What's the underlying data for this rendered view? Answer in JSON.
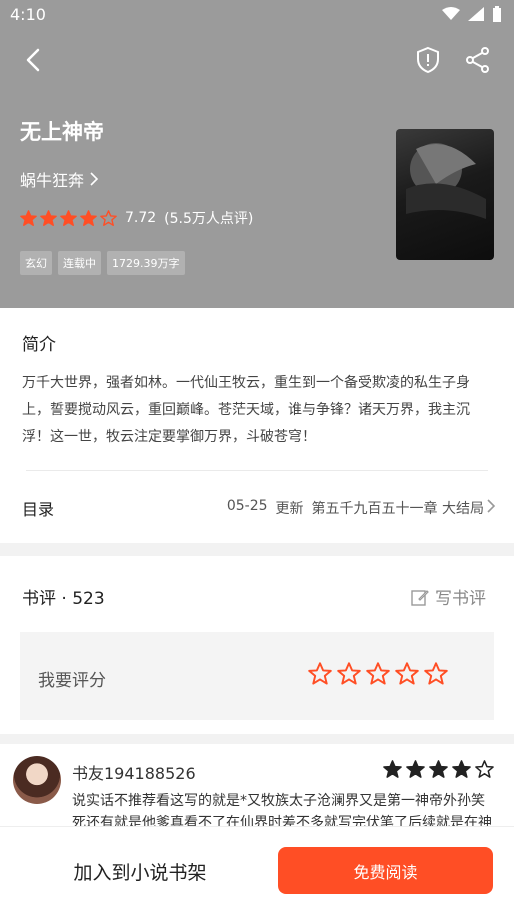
{
  "status_bar": {
    "time": "4:10"
  },
  "book": {
    "title": "无上神帝",
    "author": "蜗牛狂奔",
    "score": "7.72",
    "rating_count": "(5.5万人点评)",
    "star_rating": 4.5,
    "tags": [
      "玄幻",
      "连载中",
      "1729.39万字"
    ],
    "cover_text": "无上神帝"
  },
  "intro": {
    "heading": "简介",
    "text": "万千大世界，强者如林。一代仙王牧云，重生到一个备受欺凌的私生子身上，誓要搅动风云，重回巅峰。苍茫天域，谁与争锋？诸天万界，我主沉浮！这一世，牧云注定要掌御万界，斗破苍穹！"
  },
  "toc": {
    "label": "目录",
    "date": "05-25",
    "update": "更新",
    "latest_chapter": "第五千九百五十一章 大结局"
  },
  "reviews": {
    "heading": "书评 · 523",
    "write_label": "写书评",
    "rate_label": "我要评分",
    "item": {
      "username": "书友194188526",
      "stars": 4,
      "text": "说实话不推荐看这写的就是*又牧族太子沧澜界又是第一神帝外孙笑死还有就是他爹真看不了在仙界时差不多就写完伏笔了后续就是在神界旅途后面又是仙王归来到结尾也是这样"
    }
  },
  "bottom": {
    "add_shelf": "加入到小说书架",
    "read_free": "免费阅读"
  },
  "colors": {
    "accent": "#ff4e25",
    "header_bg": "#9b9b9b",
    "star": "#ff4e25"
  }
}
